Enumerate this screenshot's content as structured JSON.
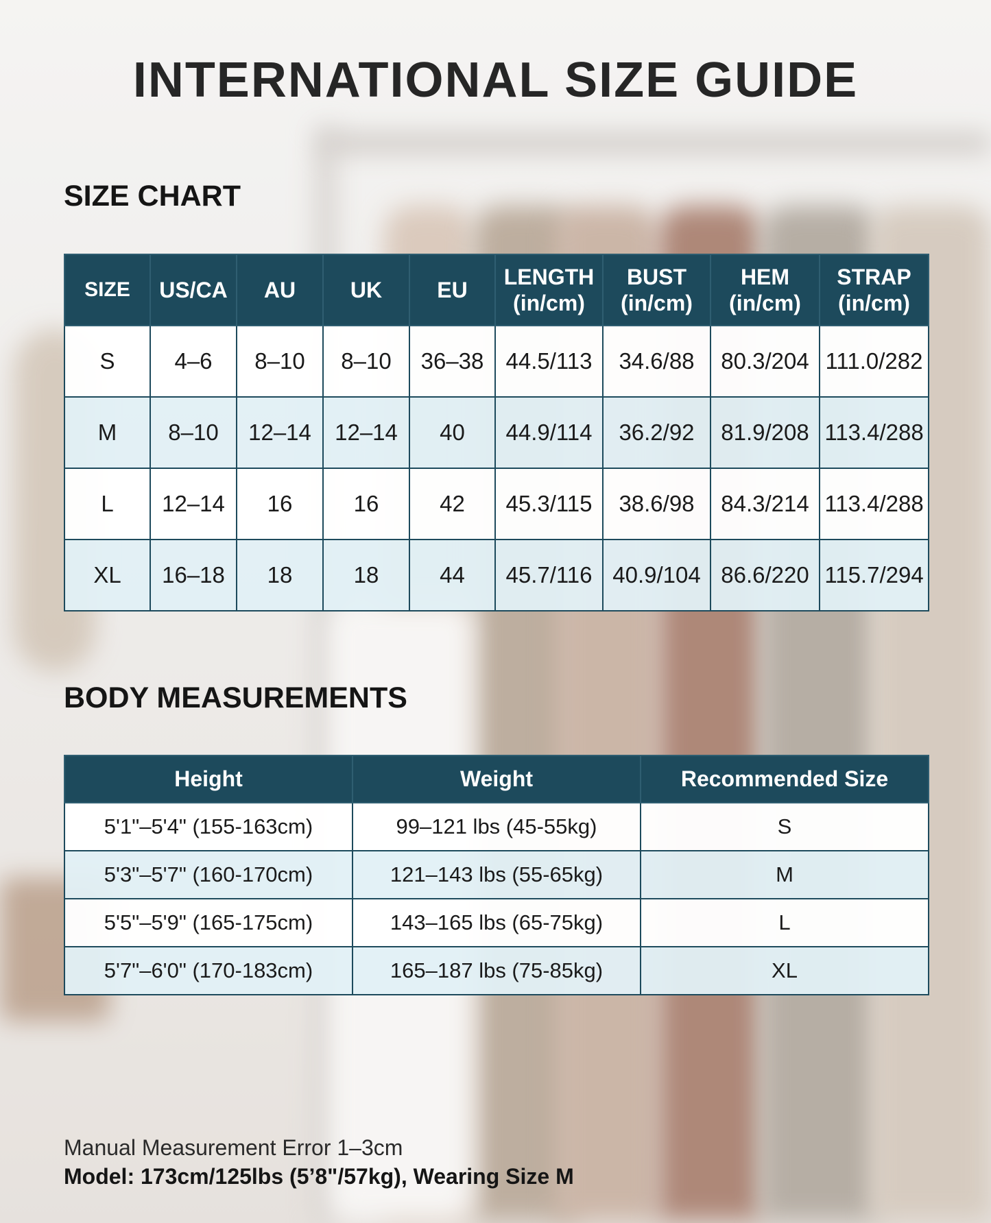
{
  "title": "INTERNATIONAL SIZE GUIDE",
  "size_chart": {
    "heading": "SIZE CHART",
    "columns": [
      {
        "line1": "SIZE",
        "line2": ""
      },
      {
        "line1": "US/CA",
        "line2": ""
      },
      {
        "line1": "AU",
        "line2": ""
      },
      {
        "line1": "UK",
        "line2": ""
      },
      {
        "line1": "EU",
        "line2": ""
      },
      {
        "line1": "LENGTH",
        "line2": "(in/cm)"
      },
      {
        "line1": "BUST",
        "line2": "(in/cm)"
      },
      {
        "line1": "HEM",
        "line2": "(in/cm)"
      },
      {
        "line1": "STRAP",
        "line2": "(in/cm)"
      }
    ],
    "rows": [
      [
        "S",
        "4–6",
        "8–10",
        "8–10",
        "36–38",
        "44.5/113",
        "34.6/88",
        "80.3/204",
        "111.0/282"
      ],
      [
        "M",
        "8–10",
        "12–14",
        "12–14",
        "40",
        "44.9/114",
        "36.2/92",
        "81.9/208",
        "113.4/288"
      ],
      [
        "L",
        "12–14",
        "16",
        "16",
        "42",
        "45.3/115",
        "38.6/98",
        "84.3/214",
        "113.4/288"
      ],
      [
        "XL",
        "16–18",
        "18",
        "18",
        "44",
        "45.7/116",
        "40.9/104",
        "86.6/220",
        "115.7/294"
      ]
    ]
  },
  "body_measurements": {
    "heading": "BODY MEASUREMENTS",
    "columns": [
      "Height",
      "Weight",
      "Recommended Size"
    ],
    "rows": [
      [
        "5'1\"–5'4\" (155-163cm)",
        "99–121 lbs (45-55kg)",
        "S"
      ],
      [
        "5'3\"–5'7\" (160-170cm)",
        "121–143 lbs (55-65kg)",
        "M"
      ],
      [
        "5'5\"–5'9\" (165-175cm)",
        "143–165 lbs (65-75kg)",
        "L"
      ],
      [
        "5'7\"–6'0\" (170-183cm)",
        "165–187 lbs (75-85kg)",
        "XL"
      ]
    ]
  },
  "footer": {
    "note": "Manual Measurement Error 1–3cm",
    "model": "Model: 173cm/125lbs (5’8\"/57kg), Wearing Size M"
  },
  "colors": {
    "header_bg": "#1d4a5c",
    "row_light": "#ffffff",
    "row_tint": "#e2f0f6"
  }
}
